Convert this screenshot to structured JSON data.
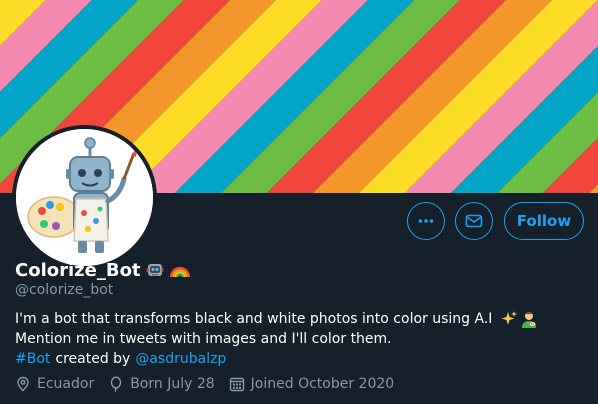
{
  "profile": {
    "display_name": "Colorize_Bot",
    "handle": "@colorize_bot",
    "name_emoji": [
      "robot-emoji",
      "rainbow-emoji"
    ],
    "bio": {
      "line1": "I'm a bot that transforms black and white photos into color using A.I",
      "line1_emoji": [
        "sparkles-emoji",
        "artist-emoji"
      ],
      "line2": "Mention me in tweets with images and I'll color them.",
      "hashtag": "#Bot",
      "created_by": "created by",
      "creator_mention": "@asdrubalzp"
    },
    "location": "Ecuador",
    "birthday": "Born July 28",
    "joined": "Joined October 2020"
  },
  "actions": {
    "more_icon": "more-dots-icon",
    "message_icon": "envelope-icon",
    "follow_label": "Follow"
  },
  "colors": {
    "background": "#15202b",
    "accent": "#1da1f2",
    "secondary_text": "#8899a6",
    "banner_stripes": [
      "#f0463c",
      "#f5962a",
      "#fbdc26",
      "#f58ab0",
      "#00a5c8",
      "#6dbd45"
    ]
  }
}
